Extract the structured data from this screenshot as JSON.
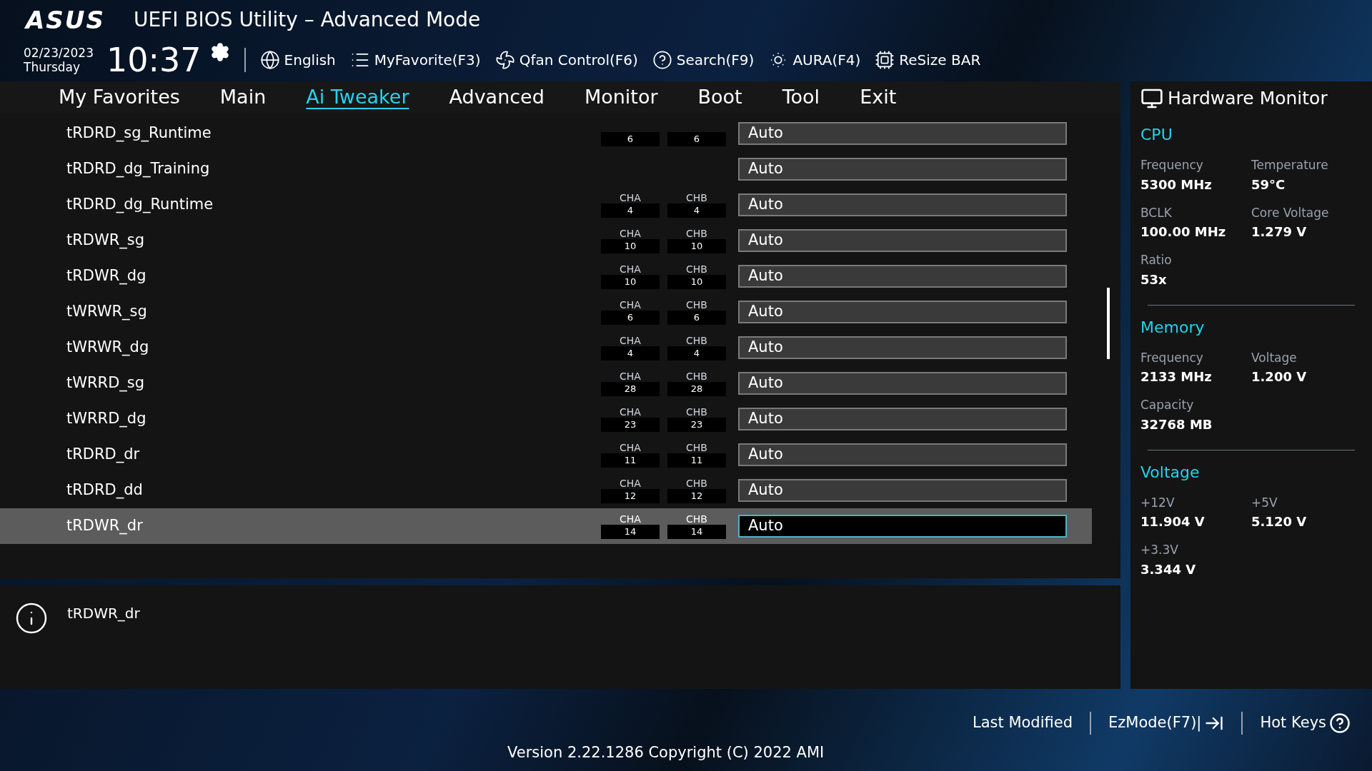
{
  "header": {
    "logo": "ASUS",
    "title": "UEFI BIOS Utility – Advanced Mode",
    "date": "02/23/2023",
    "day": "Thursday",
    "time": "10:37",
    "tools": [
      {
        "kind": "language",
        "label": "English"
      },
      {
        "kind": "favorite",
        "label": "MyFavorite(F3)"
      },
      {
        "kind": "fan",
        "label": "Qfan Control(F6)"
      },
      {
        "kind": "search",
        "label": "Search(F9)"
      },
      {
        "kind": "aura",
        "label": "AURA(F4)"
      },
      {
        "kind": "bar",
        "label": "ReSize BAR"
      }
    ]
  },
  "tabs": [
    {
      "label": "My Favorites",
      "selected": false
    },
    {
      "label": "Main",
      "selected": false
    },
    {
      "label": "Ai Tweaker",
      "selected": true
    },
    {
      "label": "Advanced",
      "selected": false
    },
    {
      "label": "Monitor",
      "selected": false
    },
    {
      "label": "Boot",
      "selected": false
    },
    {
      "label": "Tool",
      "selected": false
    },
    {
      "label": "Exit",
      "selected": false
    }
  ],
  "settings": [
    {
      "kind": "channels",
      "label": "tRDRD_sg_Runtime",
      "cha": "6",
      "chb": "6",
      "value": "Auto",
      "selected": false
    },
    {
      "kind": "plain",
      "label": "tRDRD_dg_Training",
      "value": "Auto",
      "selected": false
    },
    {
      "kind": "channels",
      "label": "tRDRD_dg_Runtime",
      "cha_label": "CHA",
      "cha": "4",
      "chb_label": "CHB",
      "chb": "4",
      "value": "Auto",
      "selected": false
    },
    {
      "kind": "channels",
      "label": "tRDWR_sg",
      "cha_label": "CHA",
      "cha": "10",
      "chb_label": "CHB",
      "chb": "10",
      "value": "Auto",
      "selected": false
    },
    {
      "kind": "channels",
      "label": "tRDWR_dg",
      "cha_label": "CHA",
      "cha": "10",
      "chb_label": "CHB",
      "chb": "10",
      "value": "Auto",
      "selected": false
    },
    {
      "kind": "channels",
      "label": "tWRWR_sg",
      "cha_label": "CHA",
      "cha": "6",
      "chb_label": "CHB",
      "chb": "6",
      "value": "Auto",
      "selected": false
    },
    {
      "kind": "channels",
      "label": "tWRWR_dg",
      "cha_label": "CHA",
      "cha": "4",
      "chb_label": "CHB",
      "chb": "4",
      "value": "Auto",
      "selected": false
    },
    {
      "kind": "channels",
      "label": "tWRRD_sg",
      "cha_label": "CHA",
      "cha": "28",
      "chb_label": "CHB",
      "chb": "28",
      "value": "Auto",
      "selected": false
    },
    {
      "kind": "channels",
      "label": "tWRRD_dg",
      "cha_label": "CHA",
      "cha": "23",
      "chb_label": "CHB",
      "chb": "23",
      "value": "Auto",
      "selected": false
    },
    {
      "kind": "channels",
      "label": "tRDRD_dr",
      "cha_label": "CHA",
      "cha": "11",
      "chb_label": "CHB",
      "chb": "11",
      "value": "Auto",
      "selected": false
    },
    {
      "kind": "channels",
      "label": "tRDRD_dd",
      "cha_label": "CHA",
      "cha": "12",
      "chb_label": "CHB",
      "chb": "12",
      "value": "Auto",
      "selected": false
    },
    {
      "kind": "channels",
      "label": "tRDWR_dr",
      "cha_label": "CHA",
      "cha": "14",
      "chb_label": "CHB",
      "chb": "14",
      "value": "Auto",
      "selected": true
    }
  ],
  "help": {
    "text": "tRDWR_dr"
  },
  "monitor": {
    "title": "Hardware Monitor",
    "sections": [
      {
        "title": "CPU",
        "items": [
          {
            "label": "Frequency",
            "value": "5300 MHz"
          },
          {
            "label": "Temperature",
            "value": "59°C"
          },
          {
            "label": "BCLK",
            "value": "100.00 MHz"
          },
          {
            "label": "Core Voltage",
            "value": "1.279 V"
          },
          {
            "label": "Ratio",
            "value": "53x"
          }
        ]
      },
      {
        "title": "Memory",
        "items": [
          {
            "label": "Frequency",
            "value": "2133 MHz"
          },
          {
            "label": "Voltage",
            "value": "1.200 V"
          },
          {
            "label": "Capacity",
            "value": "32768 MB"
          }
        ]
      },
      {
        "title": "Voltage",
        "items": [
          {
            "label": "+12V",
            "value": "11.904 V"
          },
          {
            "label": "+5V",
            "value": "5.120 V"
          },
          {
            "label": "+3.3V",
            "value": "3.344 V"
          }
        ]
      }
    ]
  },
  "footer": {
    "links": [
      {
        "kind": "plain",
        "label": "Last Modified"
      },
      {
        "kind": "exit",
        "label": "EzMode(F7)|"
      },
      {
        "kind": "help",
        "label": "Hot Keys"
      }
    ],
    "version": "Version 2.22.1286 Copyright (C) 2022 AMI"
  }
}
